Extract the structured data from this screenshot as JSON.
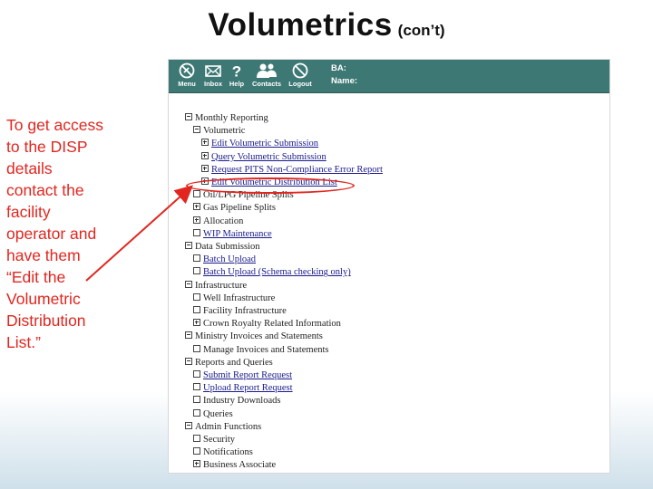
{
  "slide": {
    "title": "Volumetrics",
    "subtitle": "(con’t)",
    "note_lines": [
      "To get access",
      "to the DISP",
      "details",
      "contact the",
      "facility",
      "operator and",
      "have them",
      "“Edit the",
      "Volumetric",
      "Distribution",
      "List.”"
    ]
  },
  "toolbar": {
    "items": [
      {
        "label": "Menu",
        "icon": "menu-icon"
      },
      {
        "label": "Inbox",
        "icon": "inbox-icon"
      },
      {
        "label": "Help",
        "icon": "help-icon"
      },
      {
        "label": "Contacts",
        "icon": "contacts-icon"
      },
      {
        "label": "Logout",
        "icon": "logout-icon"
      }
    ],
    "ba_label": "BA:",
    "name_label": "Name:"
  },
  "tree": [
    {
      "label": "Monthly Reporting",
      "level": 0,
      "box": "minus",
      "link": false
    },
    {
      "label": "Volumetric",
      "level": 1,
      "box": "minus",
      "link": false
    },
    {
      "label": "Edit Volumetric Submission",
      "level": 2,
      "box": "plus",
      "link": true
    },
    {
      "label": "Query Volumetric Submission",
      "level": 2,
      "box": "plus",
      "link": true
    },
    {
      "label": "Request PITS Non-Compliance Error Report",
      "level": 2,
      "box": "plus",
      "link": true
    },
    {
      "label": "Edit Volumetric Distribution List",
      "level": 2,
      "box": "plus",
      "link": true
    },
    {
      "label": "Oil/LPG Pipeline Splits",
      "level": 1,
      "box": "plain",
      "link": false
    },
    {
      "label": "Gas Pipeline Splits",
      "level": 1,
      "box": "plus",
      "link": false
    },
    {
      "label": "Allocation",
      "level": 1,
      "box": "plus",
      "link": false
    },
    {
      "label": "WIP Maintenance",
      "level": 1,
      "box": "plain",
      "link": true
    },
    {
      "label": "Data Submission",
      "level": 0,
      "box": "minus",
      "link": false
    },
    {
      "label": "Batch Upload",
      "level": 1,
      "box": "plain",
      "link": true
    },
    {
      "label": "Batch Upload (Schema checking only)",
      "level": 1,
      "box": "plain",
      "link": true
    },
    {
      "label": "Infrastructure",
      "level": 0,
      "box": "minus",
      "link": false
    },
    {
      "label": "Well Infrastructure",
      "level": 1,
      "box": "plain",
      "link": false
    },
    {
      "label": "Facility Infrastructure",
      "level": 1,
      "box": "plain",
      "link": false
    },
    {
      "label": "Crown Royalty Related Information",
      "level": 1,
      "box": "plus",
      "link": false
    },
    {
      "label": "Ministry Invoices and Statements",
      "level": 0,
      "box": "minus",
      "link": false
    },
    {
      "label": "Manage Invoices and Statements",
      "level": 1,
      "box": "plain",
      "link": false
    },
    {
      "label": "Reports and Queries",
      "level": 0,
      "box": "minus",
      "link": false
    },
    {
      "label": "Submit Report Request",
      "level": 1,
      "box": "plain",
      "link": true
    },
    {
      "label": "Upload Report Request",
      "level": 1,
      "box": "plain",
      "link": true
    },
    {
      "label": "Industry Downloads",
      "level": 1,
      "box": "plain",
      "link": false
    },
    {
      "label": "Queries",
      "level": 1,
      "box": "plain",
      "link": false
    },
    {
      "label": "Admin Functions",
      "level": 0,
      "box": "minus",
      "link": false
    },
    {
      "label": "Security",
      "level": 1,
      "box": "plain",
      "link": false
    },
    {
      "label": "Notifications",
      "level": 1,
      "box": "plain",
      "link": false
    },
    {
      "label": "Business Associate",
      "level": 1,
      "box": "plus",
      "link": false
    }
  ],
  "annotation": {
    "color": "#e2261f"
  },
  "colors": {
    "toolbar": "#3d7874",
    "link": "#1a1a8c"
  }
}
